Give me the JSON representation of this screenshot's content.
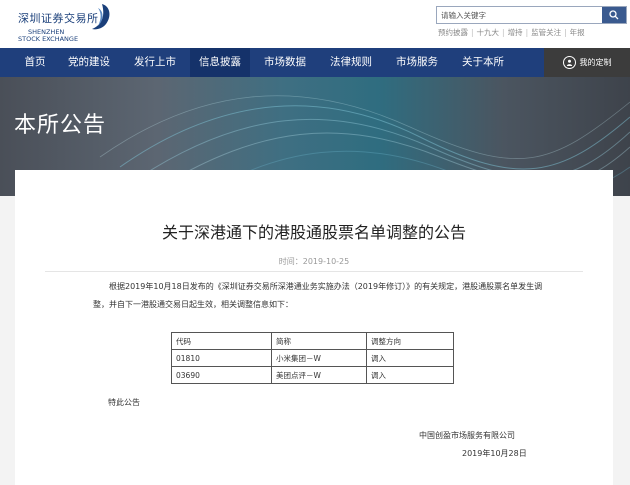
{
  "header": {
    "logo_cn": "深圳证券交易所",
    "logo_en_line1": "SHENZHEN",
    "logo_en_line2": "STOCK EXCHANGE",
    "search_placeholder": "请输入关键字",
    "quick_links": [
      "预约披露",
      "十九大",
      "增持",
      "监管关注",
      "年报"
    ]
  },
  "nav": {
    "items": [
      "首页",
      "党的建设",
      "发行上市",
      "信息披露",
      "市场数据",
      "法律规则",
      "市场服务",
      "关于本所"
    ],
    "active_index": 3,
    "custom_label": "我的定制"
  },
  "banner": {
    "title": "本所公告"
  },
  "article": {
    "title": "关于深港通下的港股通股票名单调整的公告",
    "date_label": "时间：2019-10-25",
    "paragraph": "根据2019年10月18日发布的《深圳证券交易所深港通业务实施办法（2019年修订）》的有关规定，港股通股票名单发生调整，并自下一港股通交易日起生效，相关调整信息如下：",
    "table": {
      "headers": [
        "代码",
        "简称",
        "调整方向"
      ],
      "rows": [
        [
          "01810",
          "小米集团－W",
          "调入"
        ],
        [
          "03690",
          "美团点评－W",
          "调入"
        ]
      ]
    },
    "closing": "特此公告",
    "organization": "中国创盈市场服务有限公司",
    "sign_date": "2019年10月28日"
  },
  "colors": {
    "nav_bg": "#1f3f7c",
    "nav_active": "#15326a",
    "brand": "#1a3f7a"
  }
}
